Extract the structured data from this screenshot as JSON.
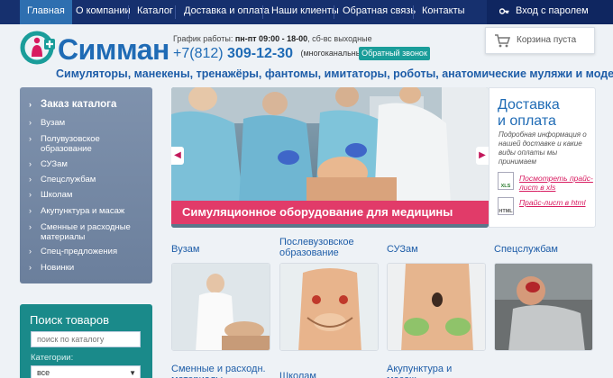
{
  "nav": {
    "items": [
      "Главная",
      "О компании",
      "Каталог",
      "Доставка и оплата",
      "Наши клиенты",
      "Обратная связь",
      "Контакты"
    ],
    "login": "Вход с паролем"
  },
  "header": {
    "logo_text": "Симман",
    "schedule_label": "График работы:",
    "schedule_hours": "пн-пт 09:00 - 18-00",
    "schedule_rest": ", сб-вс выходные",
    "phone_code": "+7(812)",
    "phone_number": "309-12-30",
    "phone_note": "(многоканальный)",
    "callback_button": "Обратный звонок",
    "cart": "Корзина пуста",
    "tagline": "Симуляторы, манекены, тренажёры, фантомы, имитаторы, роботы, анатомические муляжи и модели"
  },
  "sidebar": {
    "items": [
      "Заказ каталога",
      "Вузам",
      "Полувузовское образование",
      "СУЗам",
      "Спецслужбам",
      "Школам",
      "Акупунктура и масаж",
      "Сменные и расходные материалы",
      "Спец-предложения",
      "Новинки"
    ]
  },
  "search": {
    "title": "Поиск товаров",
    "placeholder": "поиск по каталогу",
    "category_label": "Категории:",
    "category_value": "все"
  },
  "banner": {
    "caption": "Симуляционное оборудование для медицины"
  },
  "delivery": {
    "title_line1": "Доставка",
    "title_line2": "и оплата",
    "description": "Подробная информация о нашей доставке и какие виды оплаты мы принимаем",
    "link_xls": "Посмотреть прайс-лист",
    "link_xls_suffix": "в xls",
    "link_html": "Прайс-лист",
    "link_html_suffix": "в html",
    "xls_label": "XLS",
    "html_label": "HTML"
  },
  "categories": {
    "row1": [
      "Вузам",
      "Послевузовское образование",
      "СУЗам",
      "Спецслужбам"
    ],
    "row2": [
      "Сменные и расходн. материалы",
      "Школам",
      "Акупунктура и масаж"
    ]
  },
  "colors": {
    "nav_bg": "#16306e",
    "nav_active": "#2e6fb0",
    "brand_blue": "#1f6bb5",
    "accent_pink": "#e13b69",
    "teal": "#1a8a8a"
  }
}
